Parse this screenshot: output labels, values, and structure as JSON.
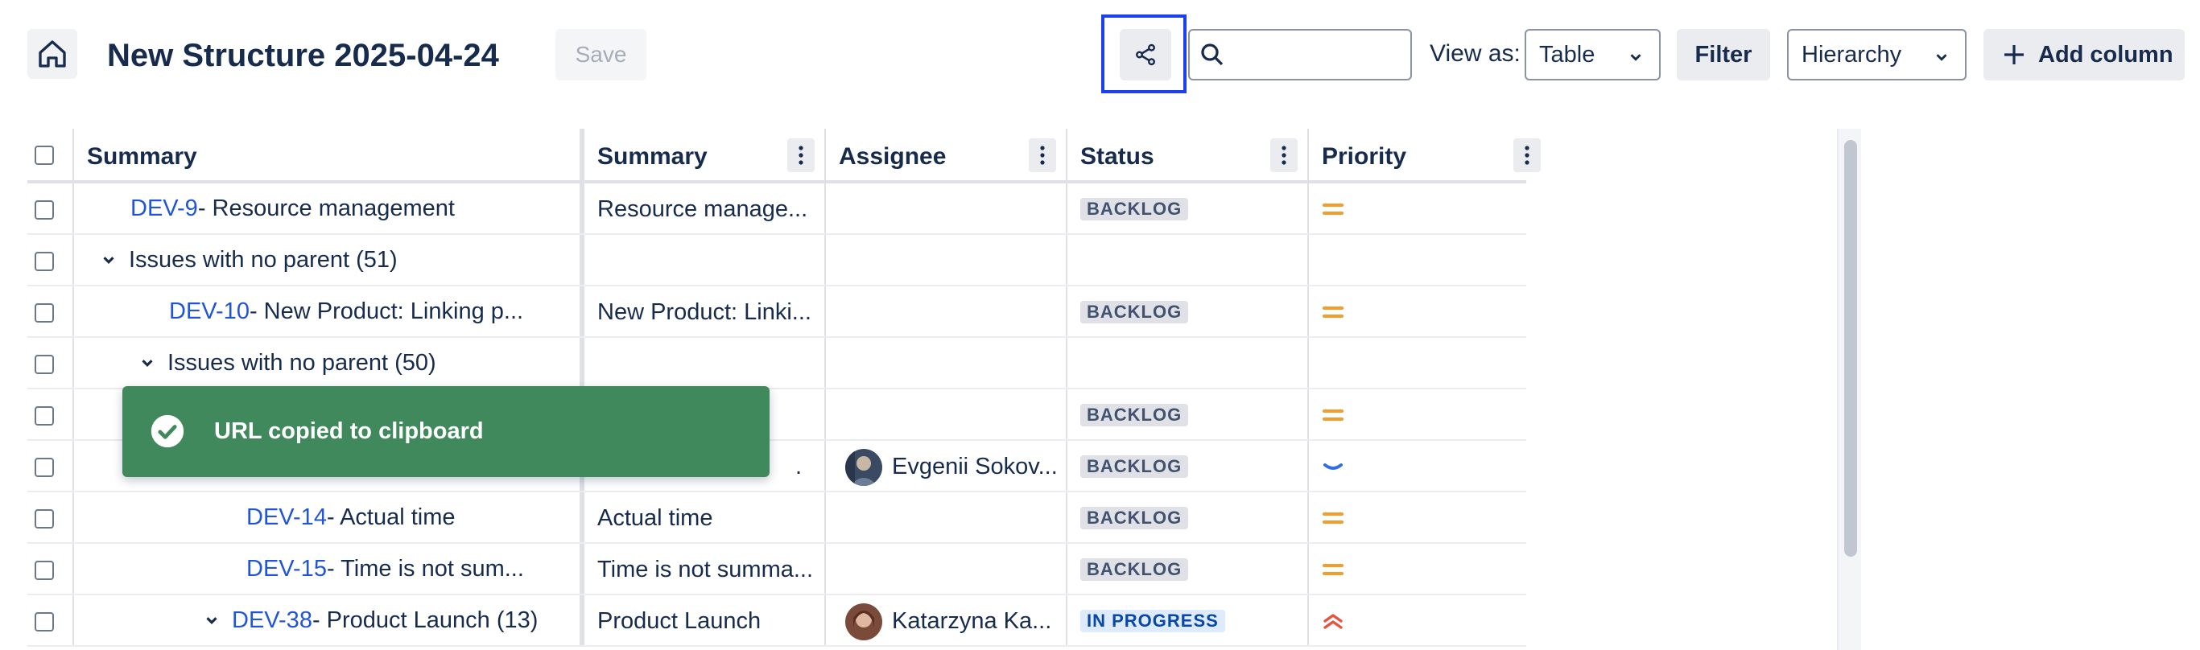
{
  "header": {
    "title": "New Structure 2025-04-24",
    "save_label": "Save",
    "search_placeholder": "",
    "view_as_label": "View as:",
    "view_as_value": "Table",
    "filter_label": "Filter",
    "mode_value": "Hierarchy",
    "add_column_label": "Add column"
  },
  "columns": [
    "Summary",
    "Summary",
    "Assignee",
    "Status",
    "Priority"
  ],
  "rows": [
    {
      "key": "DEV-9",
      "title": " - Resource management",
      "count": "",
      "summary": "Resource manage...",
      "assignee": "",
      "status": "BACKLOG",
      "priority": "medium"
    },
    {
      "key": "",
      "title": "Issues with no parent",
      "count": "(51)",
      "summary": "",
      "assignee": "",
      "status": "",
      "priority": ""
    },
    {
      "key": "DEV-10",
      "title": " - New Product: Linking p...",
      "count": "",
      "summary": "New Product: Linki...",
      "assignee": "",
      "status": "BACKLOG",
      "priority": "medium"
    },
    {
      "key": "",
      "title": "Issues with no parent",
      "count": "(50)",
      "summary": "",
      "assignee": "",
      "status": "",
      "priority": ""
    },
    {
      "key": "",
      "title": "",
      "count": "",
      "summary": "",
      "assignee": "",
      "status": "BACKLOG",
      "priority": "medium"
    },
    {
      "key": "",
      "title": "",
      "count": "",
      "summary": ".",
      "assignee": "Evgenii Sokov...",
      "status": "BACKLOG",
      "priority": "low"
    },
    {
      "key": "DEV-14",
      "title": " - Actual time",
      "count": "",
      "summary": "Actual time",
      "assignee": "",
      "status": "BACKLOG",
      "priority": "medium"
    },
    {
      "key": "DEV-15",
      "title": " - Time is not sum...",
      "count": "",
      "summary": "Time is not summa...",
      "assignee": "",
      "status": "BACKLOG",
      "priority": "medium"
    },
    {
      "key": "DEV-38",
      "title": " - Product Launch",
      "count": "(13)",
      "summary": "Product Launch",
      "assignee": "Katarzyna Ka...",
      "status": "IN PROGRESS",
      "priority": "highest"
    }
  ],
  "toast": {
    "message": "URL copied to clipboard"
  },
  "colors": {
    "accent": "#1d3ff0",
    "link": "#1f55d6",
    "toast_bg": "#40895d",
    "medium_priority": "#f29d2d",
    "low_priority": "#2f6ee6",
    "high_priority": "#e5553e"
  }
}
